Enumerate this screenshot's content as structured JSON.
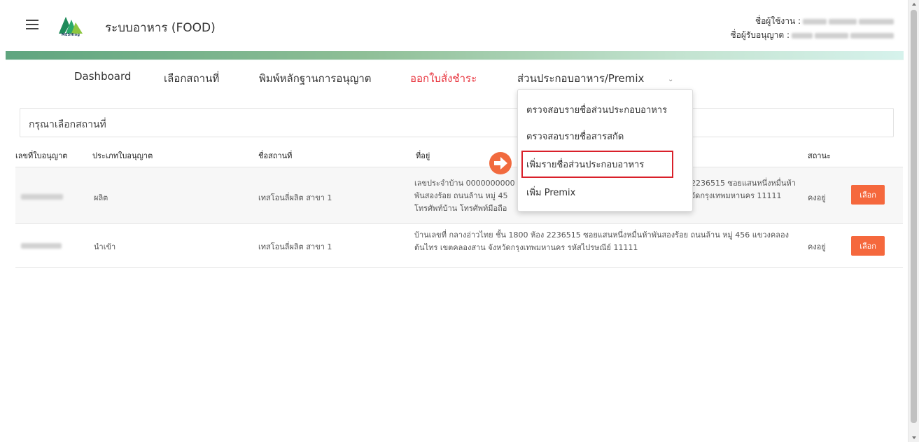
{
  "header": {
    "app_title": "ระบบอาหาร (FOOD)",
    "logo_text": "MESHlog",
    "username_label": "ชื่อผู้ใช้งาน :",
    "licensee_label": "ชื่อผู้รับอนุญาต :"
  },
  "nav": {
    "items": [
      {
        "label": "Dashboard"
      },
      {
        "label": "เลือกสถานที่"
      },
      {
        "label": "พิมพ์หลักฐานการอนุญาต"
      },
      {
        "label": "ออกใบสั่งชำระ"
      },
      {
        "label": "ส่วนประกอบอาหาร/Premix"
      }
    ],
    "active_color": "#e8333d"
  },
  "dropdown": {
    "items": [
      {
        "label": "ตรวจสอบรายชื่อส่วนประกอบอาหาร"
      },
      {
        "label": "ตรวจสอบรายชื่อสารสกัด"
      },
      {
        "label": "เพิ่มรายชื่อส่วนประกอบอาหาร"
      },
      {
        "label": "เพิ่ม Premix"
      }
    ],
    "highlight_color": "#d9202a"
  },
  "card": {
    "title": "กรุณาเลือกสถานที่"
  },
  "table": {
    "columns": [
      "เลขที่ใบอนุญาต",
      "ประเภทใบอนุญาต",
      "ชื่อสถานที่",
      "ที่อยู่",
      "สถานะ"
    ],
    "rows": [
      {
        "type": "ผลิต",
        "place": "เทสโอนลี่ผลิต สาขา 1",
        "address_left": "เลขประจำบ้าน 0000000000\nพันสองร้อย ถนนล้าน หมู่ 45\nโทรศัพท์บ้าน โทรศัพท์มือถือ",
        "address_right": "2236515 ซอยแสนหนึ่งหมื่นห้า\nวัดกรุงเทพมหานคร 11111",
        "status": "คงอยู่",
        "button": "เลือก"
      },
      {
        "type": "นำเข้า",
        "place": "เทสโอนลี่ผลิต สาขา 1",
        "address": "บ้านเลขที่ กลางอ่าวไทย ชั้น 1800 ห้อง 2236515 ซอยแสนหนึ่งหมื่นห้าพันสองร้อย ถนนล้าน หมู่ 456 แขวงคลองต้นไทร เขตคลองสาน จังหวัดกรุงเทพมหานคร รหัสไปรษณีย์ 11111",
        "status": "คงอยู่",
        "button": "เลือก"
      }
    ],
    "button_color": "#f5683d"
  },
  "icons": [
    "menu-icon",
    "arrow-right-circle-icon",
    "chevron-down-icon"
  ]
}
